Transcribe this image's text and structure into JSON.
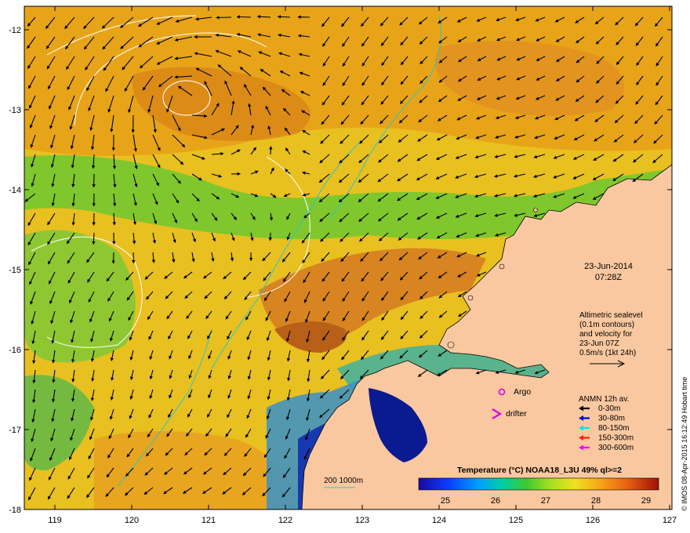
{
  "map": {
    "lat_ticks": [
      "-12",
      "-13",
      "-14",
      "-15",
      "-16",
      "-17",
      "-18"
    ],
    "lon_ticks": [
      "119",
      "120",
      "121",
      "122",
      "123",
      "124",
      "125",
      "126",
      "127"
    ],
    "date": "23-Jun-2014",
    "time": "07:28Z",
    "info_lines": [
      "Altimetric sealevel",
      "(0.1m contours)",
      "and velocity for",
      "23-Jun 07Z",
      "0.5m/s (1kt 24h)"
    ],
    "markers": {
      "argo_label": "Argo",
      "drifter_label": "drifter",
      "argo_color": "#e000e0",
      "drifter_color": "#e000e0"
    },
    "anmn": {
      "title": "ANMN 12h av.",
      "items": [
        {
          "label": "0-30m",
          "color": "#000000"
        },
        {
          "label": "30-80m",
          "color": "#0000dd"
        },
        {
          "label": "80-150m",
          "color": "#00e5e5"
        },
        {
          "label": "150-300m",
          "color": "#ff2200"
        },
        {
          "label": "300-600m",
          "color": "#ff00ff"
        }
      ]
    },
    "bathy_label": "200  1000m",
    "bathy_color": "#28c8c8",
    "land_color": "#fac8a0",
    "colorbar": {
      "title": "Temperature (°C) NOAA18_L3U 49% ql>=2",
      "ticks": [
        "25",
        "26",
        "27",
        "28",
        "29"
      ]
    },
    "credit": "© IMOS 08-Apr-2015 16:12:49 Hobart time"
  }
}
